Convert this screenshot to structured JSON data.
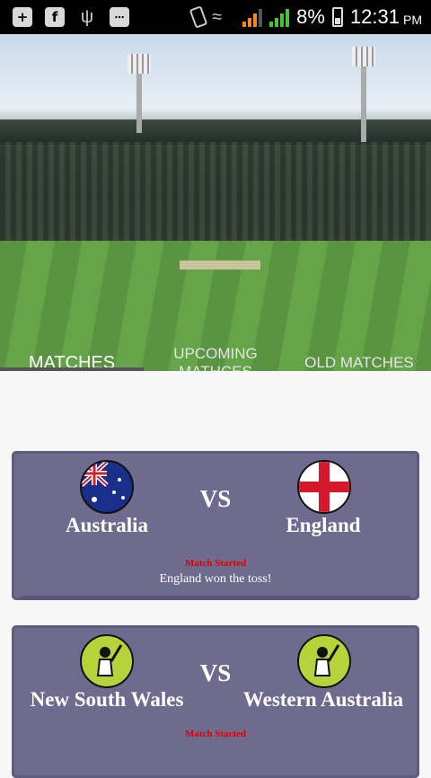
{
  "statusbar": {
    "battery": "8%",
    "time": "12:31",
    "ampm": "PM",
    "icons": [
      "plus-square-icon",
      "facebook-icon",
      "usb-icon",
      "chat-icon",
      "phone-vibrate-icon",
      "wifi-icon",
      "signal-icon",
      "battery-icon"
    ]
  },
  "tabs": [
    {
      "label": "MATCHES"
    },
    {
      "label": "UPCOMING\nMATHCES"
    },
    {
      "label": "OLD MATCHES"
    }
  ],
  "matches": [
    {
      "team1": "Australia",
      "team2": "England",
      "vs": "VS",
      "status": "Match Started",
      "result": "England won the toss!"
    },
    {
      "team1": "New South Wales",
      "team2": "Western Australia",
      "vs": "VS",
      "status": "Match Started"
    }
  ],
  "colors": {
    "card": "#6f6b8f",
    "status": "#e00000",
    "background": "#f7f7f7"
  }
}
